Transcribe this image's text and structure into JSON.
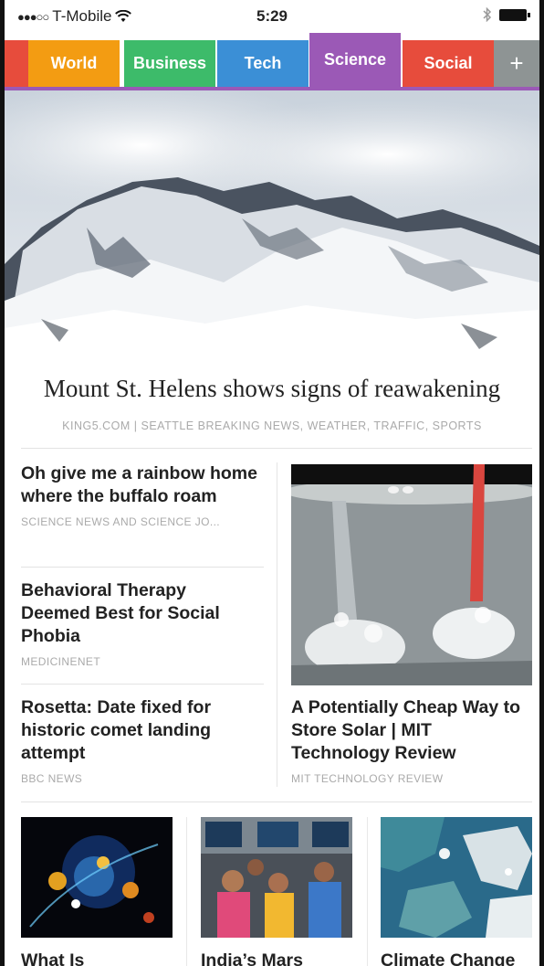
{
  "status": {
    "signal": "●●●○○",
    "carrier": "T-Mobile",
    "wifi": "wifi-icon",
    "time": "5:29",
    "bluetooth": "bluetooth-icon",
    "battery": "battery-icon"
  },
  "tabs": {
    "world": "World",
    "business": "Business",
    "tech": "Tech",
    "science": "Science",
    "social": "Social",
    "add": "+",
    "active": "Science"
  },
  "colors": {
    "world": "#f39c12",
    "business": "#3dbb6a",
    "tech": "#3b8fd6",
    "science": "#9b59b6",
    "social": "#e74c3c",
    "add": "#8e9494"
  },
  "main_story": {
    "headline": "Mount St. Helens shows signs of reawakening",
    "source": "KING5.COM | SEATTLE BREAKING NEWS, WEATHER, TRAFFIC, SPORTS"
  },
  "left_stories": [
    {
      "title": "Oh give me a rainbow home where the buffalo roam",
      "source": "SCIENCE NEWS AND SCIENCE JO..."
    },
    {
      "title": "Behavioral Therapy Deemed Best for Social Phobia",
      "source": "MEDICINENET"
    },
    {
      "title": "Rosetta: Date fixed for historic comet landing attempt",
      "source": "BBC NEWS"
    }
  ],
  "right_story": {
    "title": "A Potentially Cheap Way to Store Solar | MIT Technology Review",
    "source": "MIT TECHNOLOGY REVIEW"
  },
  "cards": [
    {
      "title": "What Is"
    },
    {
      "title": "India’s Mars"
    },
    {
      "title": "Climate Change"
    }
  ]
}
